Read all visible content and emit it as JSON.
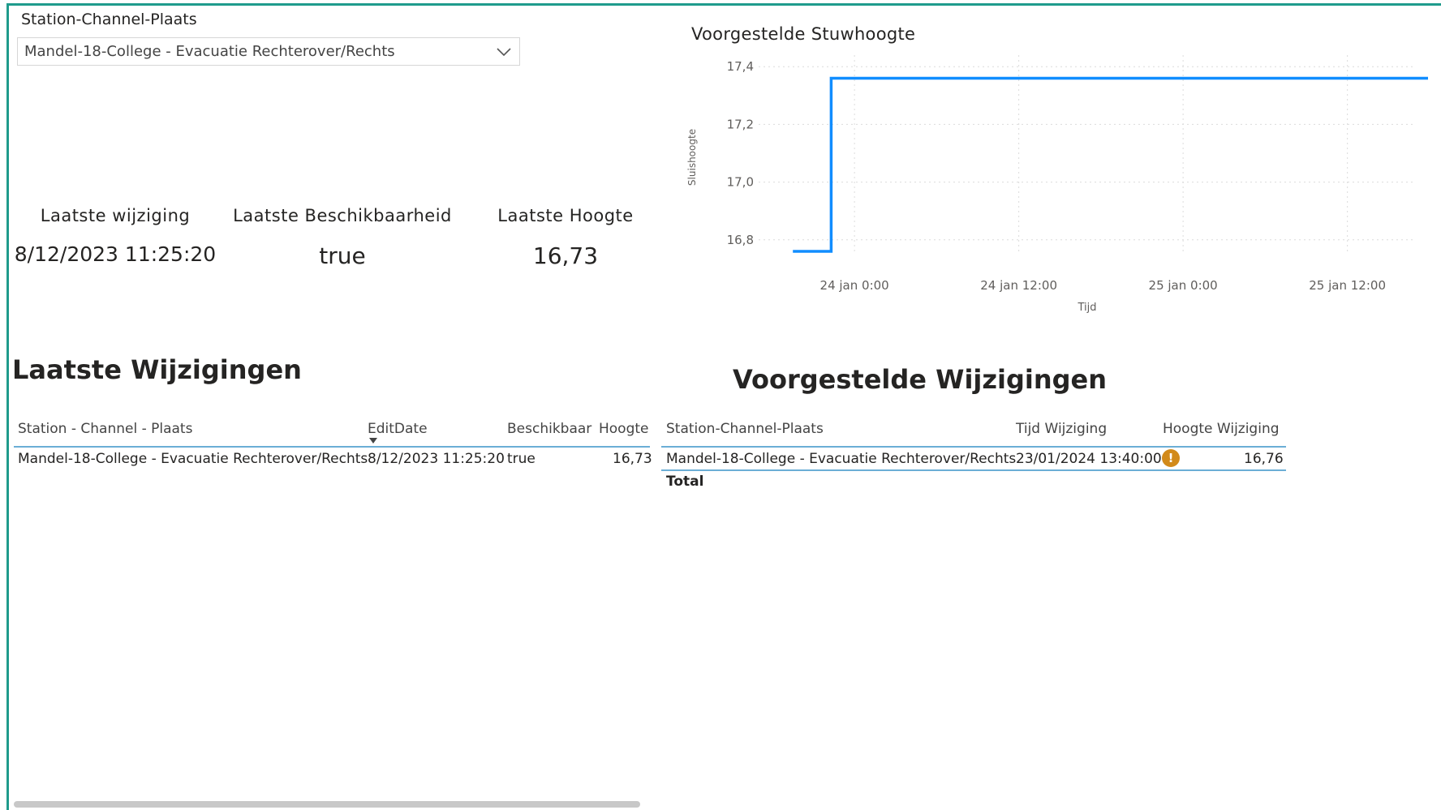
{
  "slicer": {
    "title": "Station-Channel-Plaats",
    "value": "Mandel-18-College - Evacuatie Rechterover/Rechts"
  },
  "cards": [
    {
      "label": "Laatste wijziging",
      "value": "8/12/2023 11:25:20"
    },
    {
      "label": "Laatste Beschikbaarheid",
      "value": "true"
    },
    {
      "label": "Laatste Hoogte",
      "value": "16,73"
    }
  ],
  "chart": {
    "title": "Voorgestelde Stuwhoogte"
  },
  "chart_data": {
    "type": "line",
    "title": "Voorgestelde Stuwhoogte",
    "xlabel": "Tijd",
    "ylabel": "Sluishoogte",
    "y_ticks": [
      "17,4",
      "17,2",
      "17,0",
      "16,8"
    ],
    "y_tick_values": [
      17.4,
      17.2,
      17.0,
      16.8
    ],
    "x_ticks": [
      "24 jan 0:00",
      "24 jan 12:00",
      "25 jan 0:00",
      "25 jan 12:00"
    ],
    "x_tick_hours": [
      0,
      12,
      24,
      36
    ],
    "ylim": [
      16.76,
      17.44
    ],
    "xlim_hours": [
      -7,
      41
    ],
    "grid": true,
    "series": [
      {
        "x_hours": [
          -4.5,
          -1.7,
          -1.7,
          42.0
        ],
        "y": [
          16.76,
          16.76,
          17.36,
          17.36
        ]
      }
    ],
    "color": "#118dff"
  },
  "left_table": {
    "heading": "Laatste Wijzigingen",
    "columns": [
      "Station - Channel - Plaats",
      "EditDate",
      "Beschikbaar",
      "Hoogte"
    ],
    "rows": [
      [
        "Mandel-18-College - Evacuatie Rechterover/Rechts",
        "8/12/2023 11:25:20",
        "true",
        "16,73"
      ]
    ]
  },
  "right_table": {
    "heading": "Voorgestelde Wijzigingen",
    "columns": [
      "Station-Channel-Plaats",
      "Tijd Wijziging",
      "Hoogte Wijziging"
    ],
    "rows": [
      [
        "Mandel-18-College - Evacuatie Rechterover/Rechts",
        "23/01/2024 13:40:00",
        "16,76"
      ]
    ],
    "warning_icon": "!",
    "total_label": "Total"
  },
  "colors": {
    "accent_border": "#1f9b8c",
    "line": "#118dff",
    "warning": "#d28a1a",
    "header_rule": "#6baed6"
  }
}
